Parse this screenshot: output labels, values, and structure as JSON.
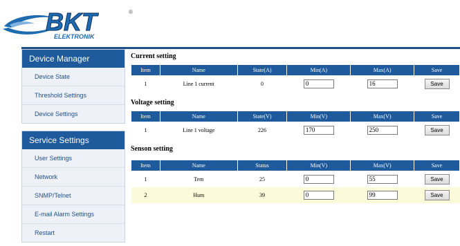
{
  "brand": {
    "logo_text": "BKT",
    "logo_sub": "ELEKTRONIK",
    "logo_mark": "®"
  },
  "sidebar": {
    "device_manager": {
      "title": "Device Manager",
      "items": [
        {
          "label": "Device State"
        },
        {
          "label": "Threshold Settings"
        },
        {
          "label": "Device Settings"
        }
      ]
    },
    "service_settings": {
      "title": "Service Settings",
      "items": [
        {
          "label": "User Settings"
        },
        {
          "label": "Network"
        },
        {
          "label": "SNMP/Telnet"
        },
        {
          "label": "E-mail Alarm Settings"
        },
        {
          "label": "Restart"
        }
      ]
    }
  },
  "current": {
    "title": "Current setting",
    "headers": [
      "Item",
      "Name",
      "State(A)",
      "Min(A)",
      "Max(A)",
      "Save"
    ],
    "rows": [
      {
        "item": "1",
        "name": "Line 1 current",
        "state": "0",
        "min": "0",
        "max": "16",
        "save": "Save"
      }
    ]
  },
  "voltage": {
    "title": "Voltage setting",
    "headers": [
      "Item",
      "Name",
      "State(V)",
      "Min(V)",
      "Max(V)",
      "Save"
    ],
    "rows": [
      {
        "item": "1",
        "name": "Line 1 voltage",
        "state": "226",
        "min": "170",
        "max": "250",
        "save": "Save"
      }
    ]
  },
  "sensor": {
    "title": "Senson setting",
    "headers": [
      "Item",
      "Name",
      "Status",
      "Min(V)",
      "Max(V)",
      "Save"
    ],
    "rows": [
      {
        "item": "1",
        "name": "Tem",
        "state": "25",
        "min": "0",
        "max": "55",
        "save": "Save"
      },
      {
        "item": "2",
        "name": "Hum",
        "state": "39",
        "min": "0",
        "max": "99",
        "save": "Save"
      }
    ]
  },
  "colors": {
    "accent": "#1e5a9c",
    "highlight_row": "#fbfbd9",
    "logo_blue": "#1f6bb0"
  }
}
